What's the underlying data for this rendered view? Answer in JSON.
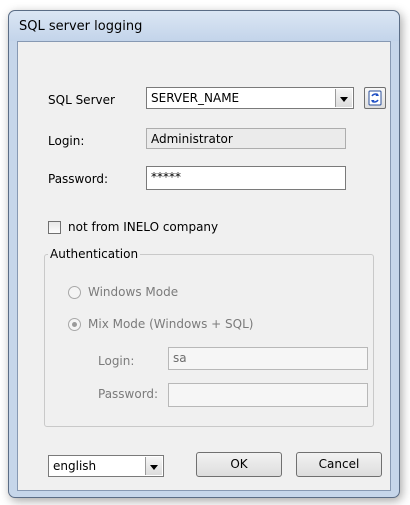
{
  "window": {
    "title": "SQL server logging"
  },
  "server": {
    "label": "SQL Server",
    "value": "SERVER_NAME",
    "refresh_icon": "refresh-icon"
  },
  "login": {
    "label": "Login:",
    "value": "Administrator"
  },
  "password": {
    "label": "Password:",
    "value": "*****"
  },
  "not_inelo": {
    "label": "not from INELO company",
    "checked": false
  },
  "authentication": {
    "legend": "Authentication",
    "windows_mode": {
      "label": "Windows Mode",
      "selected": false
    },
    "mix_mode": {
      "label": "Mix Mode (Windows + SQL)",
      "selected": true
    },
    "login_label": "Login:",
    "login_value": "sa",
    "password_label": "Password:",
    "password_value": ""
  },
  "language": {
    "value": "english"
  },
  "buttons": {
    "ok": "OK",
    "cancel": "Cancel"
  }
}
